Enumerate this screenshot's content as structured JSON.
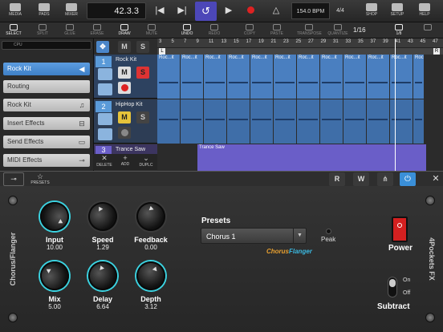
{
  "topbar": {
    "media": "MEDIA",
    "pads": "PADS",
    "mixer": "MIXER",
    "position": "42.3.3",
    "bpm": "154.0 BPM",
    "signature": "4/4",
    "shop": "SHOP",
    "setup": "SETUP",
    "help": "HELP"
  },
  "tools": {
    "select": "SELECT",
    "split": "SPLIT",
    "glue": "GLUE",
    "erase": "ERASE",
    "draw": "DRAW",
    "mute": "MUTE",
    "undo": "UNDO",
    "redo": "REDO",
    "copy": "COPY",
    "paste": "PASTE",
    "transpose": "TRANSPOSE",
    "quantize": "QUANTIZE",
    "quantize_value": "1/16",
    "grid_value": "1/8"
  },
  "left": {
    "cpu": "CPU",
    "track_name": "Rock Kit",
    "routing": "Routing",
    "instrument": "Rock Kit",
    "insert_effects": "Insert Effects",
    "send_effects": "Send Effects",
    "midi_effects": "MIDI Effects"
  },
  "tracks": [
    {
      "num": "1",
      "name": "Rock Kit"
    },
    {
      "num": "2",
      "name": "HipHop Kit"
    },
    {
      "num": "3",
      "name": "Trance Saw"
    }
  ],
  "track_buttons": {
    "delete": "DELETE",
    "add": "ADD",
    "duplicate": "DUPLC"
  },
  "ruler": [
    "3",
    "5",
    "7",
    "9",
    "11",
    "13",
    "15",
    "17",
    "19",
    "21",
    "23",
    "25",
    "27",
    "29",
    "31",
    "33",
    "35",
    "37",
    "39",
    "41",
    "43",
    "45",
    "47"
  ],
  "clip_label": "Roc...it",
  "clip3_label": "Trance Saw",
  "fx": {
    "presets_tab": "PRESETS",
    "side_left": "Chorus/Flanger",
    "side_right": "4Pockets FX",
    "presets_label": "Presets",
    "preset_value": "Chorus 1",
    "brand_chorus": "Chorus",
    "brand_flanger": "Flanger",
    "peak": "Peak",
    "power": "Power",
    "subtract": "Subtract",
    "on": "On",
    "off": "Off",
    "header_r": "R",
    "header_w": "W"
  },
  "knobs": [
    {
      "label": "Input",
      "value": "10.00"
    },
    {
      "label": "Speed",
      "value": "1.29"
    },
    {
      "label": "Feedback",
      "value": "0.00"
    },
    {
      "label": "Mix",
      "value": "5.00"
    },
    {
      "label": "Delay",
      "value": "6.64"
    },
    {
      "label": "Depth",
      "value": "3.12"
    }
  ],
  "colors": {
    "accent": "#4c47b8",
    "track_blue": "#5a9ad8",
    "clip_blue": "#4a7fc0",
    "clip_purple": "#6a5ec8",
    "knob_ring": "#3bd2e0",
    "power_red": "#d42020"
  }
}
